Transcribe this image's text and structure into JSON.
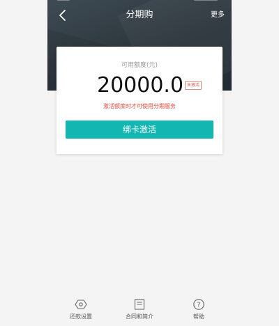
{
  "nav": {
    "title": "分期购",
    "more_label": "更多"
  },
  "card": {
    "credit_label": "可用额度(元)",
    "amount": "20000.0",
    "status_badge": "未激活",
    "notice": "激活额度时才可使用分期服务",
    "activate_button": "绑卡激活"
  },
  "bottom_tabs": [
    {
      "label": "还款设置",
      "icon": "hexagon-settings-icon"
    },
    {
      "label": "合同和简介",
      "icon": "document-icon"
    },
    {
      "label": "帮助",
      "icon": "help-circle-icon"
    }
  ],
  "colors": {
    "header_bg": "#2f3a41",
    "accent": "#13b6b0",
    "notice_red": "#e84b3c",
    "page_bg": "#f4f4f4"
  }
}
